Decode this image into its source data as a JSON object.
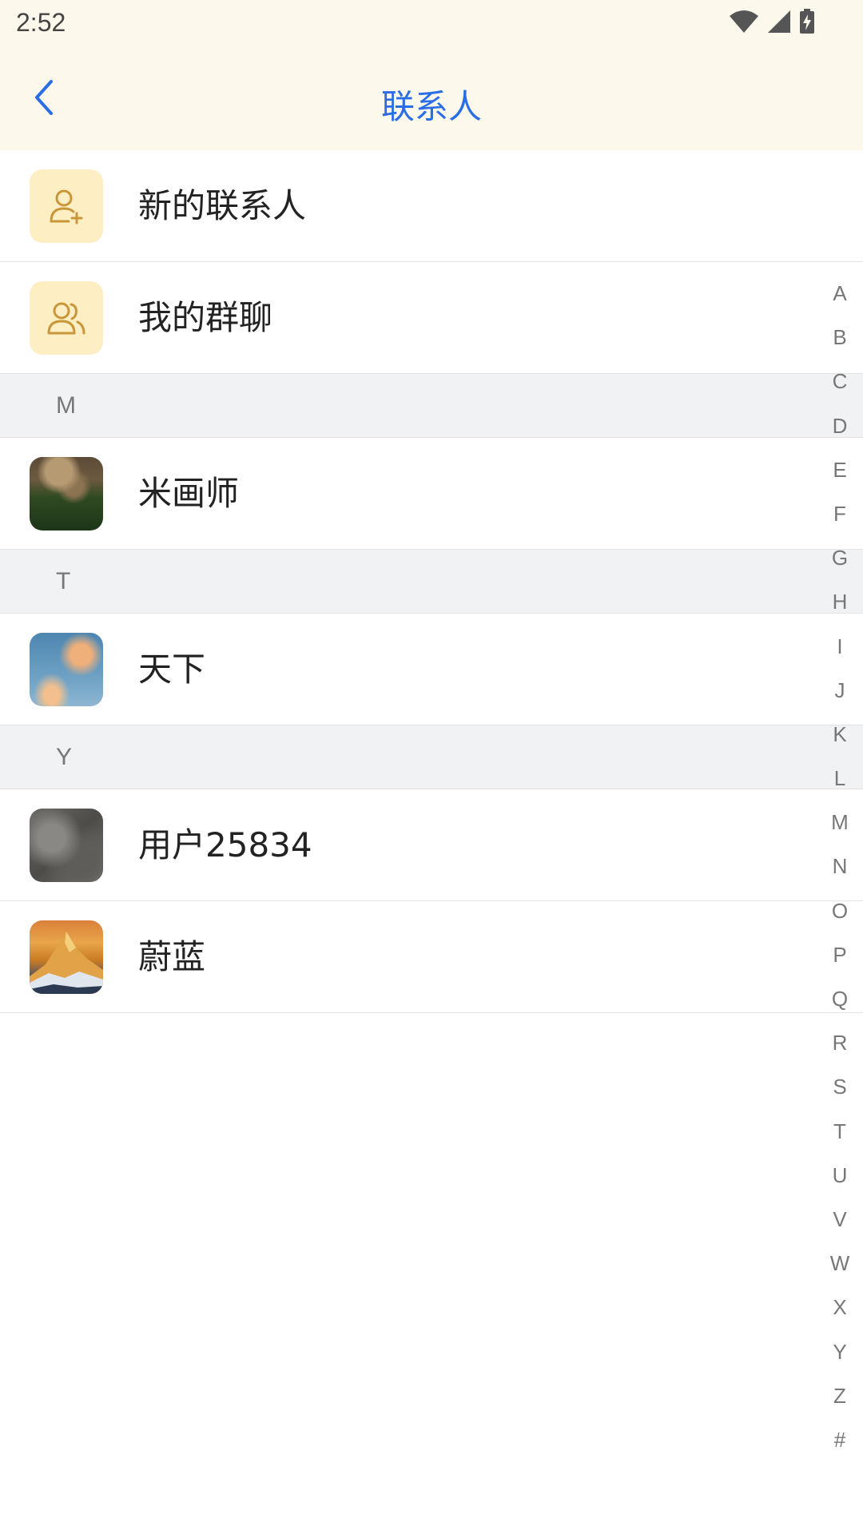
{
  "status_bar": {
    "time": "2:52",
    "icons": [
      "wifi-icon",
      "signal-icon",
      "battery-charging-icon"
    ]
  },
  "nav": {
    "back_icon": "chevron-left-icon",
    "title": "联系人",
    "accent_color": "#2a6ee6",
    "background_color": "#fdf8ec"
  },
  "features": [
    {
      "label": "新的联系人",
      "icon": "add-user-icon"
    },
    {
      "label": "我的群聊",
      "icon": "group-icon"
    }
  ],
  "sections": [
    {
      "letter": "M",
      "contacts": [
        {
          "name": "米画师",
          "avatar": "castle-photo"
        }
      ]
    },
    {
      "letter": "T",
      "contacts": [
        {
          "name": "天下",
          "avatar": "sky-photo"
        }
      ]
    },
    {
      "letter": "Y",
      "contacts": [
        {
          "name": "用户25834",
          "avatar": "stone-photo"
        },
        {
          "name": "蔚蓝",
          "avatar": "mountain-photo"
        }
      ]
    }
  ],
  "index_letters": [
    "A",
    "B",
    "C",
    "D",
    "E",
    "F",
    "G",
    "H",
    "I",
    "J",
    "K",
    "L",
    "M",
    "N",
    "O",
    "P",
    "Q",
    "R",
    "S",
    "T",
    "U",
    "V",
    "W",
    "X",
    "Y",
    "Z",
    "#"
  ]
}
